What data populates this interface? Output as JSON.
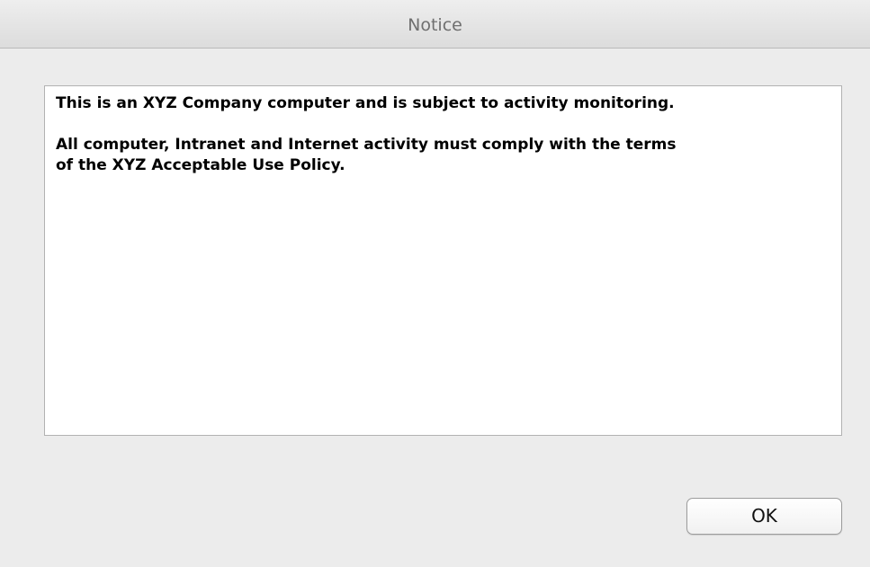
{
  "window": {
    "title": "Notice"
  },
  "message": {
    "paragraphs": [
      [
        "This is an XYZ Company computer and is subject to activity monitoring."
      ],
      [
        "All computer, Intranet and Internet activity must comply with the terms",
        "of the XYZ Acceptable Use Policy."
      ]
    ]
  },
  "buttons": {
    "ok_label": "OK"
  },
  "colors": {
    "window_background": "#ececec",
    "message_background": "#ffffff",
    "title_text": "#6f6f6f"
  }
}
